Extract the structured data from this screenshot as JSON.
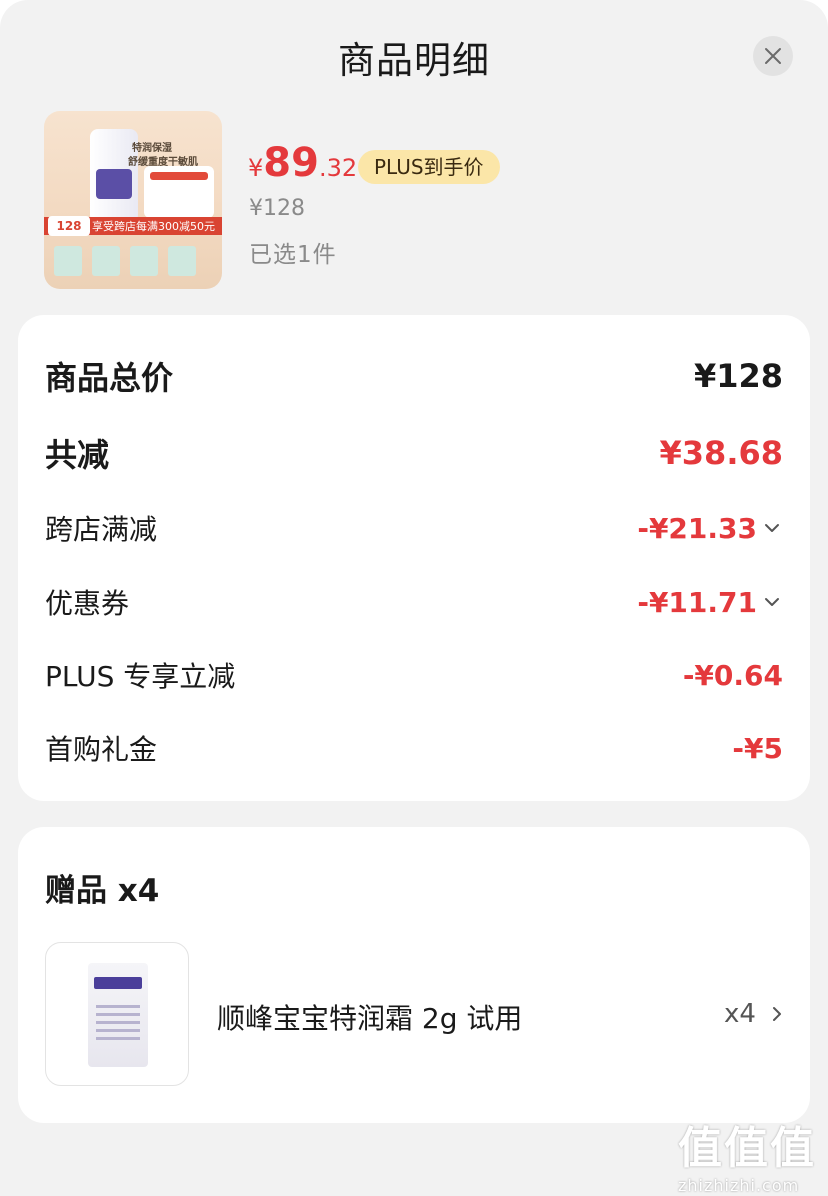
{
  "header": {
    "title": "商品明细"
  },
  "product": {
    "thumb_price": "128",
    "thumb_headline_1": "特润保湿",
    "thumb_headline_2": "舒缓重度干敏肌",
    "thumb_promo": "享受跨店每满300减50元",
    "price_yen": "¥",
    "price_int": "89",
    "price_dec": ".32",
    "plus_badge": "PLUS到手价",
    "original_price": "¥128",
    "selected_count": "已选1件"
  },
  "breakdown": {
    "rows": [
      {
        "label": "商品总价",
        "value": "¥128"
      },
      {
        "label": "共减",
        "value": "¥38.68"
      },
      {
        "label": "跨店满减",
        "value": "-¥21.33"
      },
      {
        "label": "优惠券",
        "value": "-¥11.71"
      },
      {
        "label": "PLUS 专享立减",
        "value": "-¥0.64"
      },
      {
        "label": "首购礼金",
        "value": "-¥5"
      }
    ]
  },
  "gifts": {
    "title": "赠品 x4",
    "items": [
      {
        "name": "顺峰宝宝特润霜 2g 试用",
        "qty": "x4"
      }
    ]
  },
  "watermark": {
    "logo": "值值值",
    "text": "zhizhizhi.com"
  },
  "colors": {
    "accent_red": "#e4393c",
    "plus_badge_bg": "#fbe6a8",
    "sheet_bg": "#f2f2f2"
  }
}
